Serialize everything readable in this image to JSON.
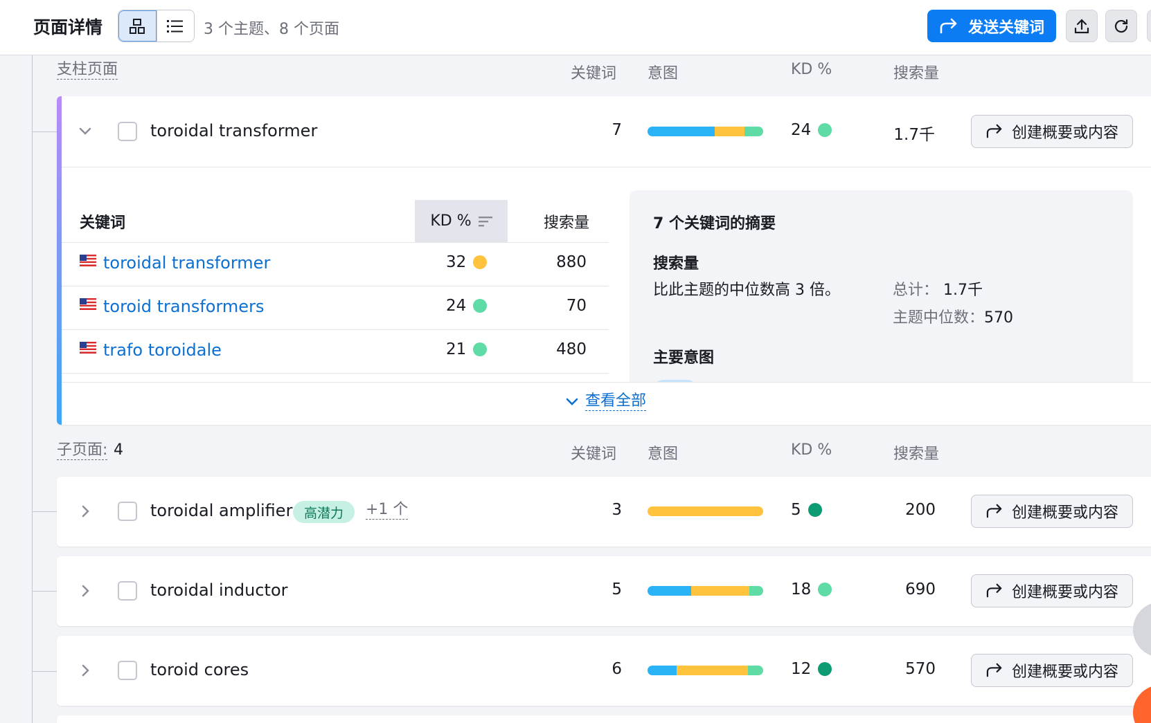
{
  "header": {
    "title": "页面详情",
    "summary": "3 个主题、8 个页面",
    "send_keywords_label": "发送关键词",
    "view_modes": [
      "grid-view-icon",
      "list-view-icon"
    ]
  },
  "columns": {
    "keywords": "关键词",
    "intent": "意图",
    "kd": "KD %",
    "volume": "搜索量"
  },
  "pillar_section": {
    "label": "支柱页面",
    "topic": {
      "name": "toroidal transformer",
      "keywords": "7",
      "intent_mix": [
        {
          "color": "#2bb3f8",
          "share": 0.58
        },
        {
          "color": "#ffc33d",
          "share": 0.26
        },
        {
          "color": "#5fdca6",
          "share": 0.16
        }
      ],
      "kd": "24",
      "kd_color": "#5fdca6",
      "volume": "1.7千",
      "create_label": "创建概要或内容"
    },
    "keyword_table": {
      "col_keyword": "关键词",
      "col_kd": "KD %",
      "col_volume": "搜索量",
      "rows": [
        {
          "keyword": "toroidal transformer",
          "kd": "32",
          "kd_color": "#ffc33d",
          "volume": "880"
        },
        {
          "keyword": "toroid transformers",
          "kd": "24",
          "kd_color": "#5fdca6",
          "volume": "70"
        },
        {
          "keyword": "trafo toroidale",
          "kd": "21",
          "kd_color": "#5fdca6",
          "volume": "480"
        }
      ]
    },
    "summary": {
      "title": "7 个关键词的摘要",
      "volume_heading": "搜索量",
      "volume_text": "比此主题的中位数高 3 倍。",
      "total_label": "总计：",
      "total_value": "1.7千",
      "median_label": "主题中位数：",
      "median_value": "570",
      "intent_heading": "主要意图"
    },
    "view_all": "查看全部"
  },
  "child_section": {
    "label": "子页面:",
    "count": "4",
    "rows": [
      {
        "name": "toroidal amplifier",
        "badge": "高潜力",
        "more": "+1 个",
        "keywords": "3",
        "intent_mix": [
          {
            "color": "#ffc33d",
            "share": 1.0
          }
        ],
        "kd": "5",
        "kd_color": "#0d9b74",
        "volume": "200",
        "create_label": "创建概要或内容"
      },
      {
        "name": "toroidal inductor",
        "keywords": "5",
        "intent_mix": [
          {
            "color": "#2bb3f8",
            "share": 0.38
          },
          {
            "color": "#ffc33d",
            "share": 0.5
          },
          {
            "color": "#5fdca6",
            "share": 0.12
          }
        ],
        "kd": "18",
        "kd_color": "#5fdca6",
        "volume": "690",
        "create_label": "创建概要或内容"
      },
      {
        "name": "toroid cores",
        "keywords": "6",
        "intent_mix": [
          {
            "color": "#2bb3f8",
            "share": 0.25
          },
          {
            "color": "#ffc33d",
            "share": 0.62
          },
          {
            "color": "#5fdca6",
            "share": 0.13
          }
        ],
        "kd": "12",
        "kd_color": "#0d9b74",
        "volume": "570",
        "create_label": "创建概要或内容"
      }
    ]
  }
}
